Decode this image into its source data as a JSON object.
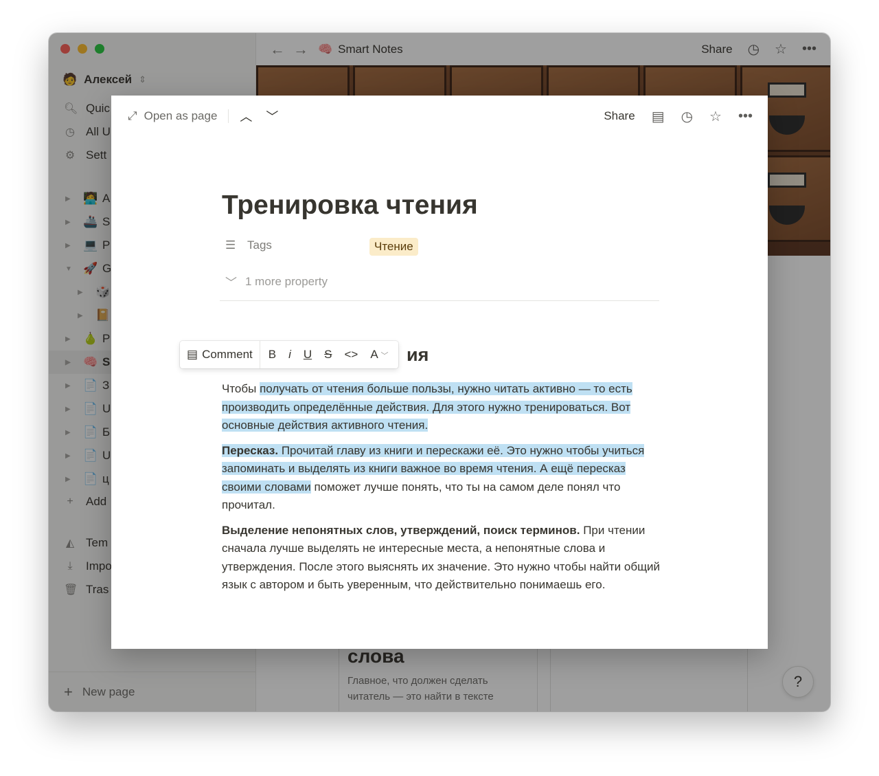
{
  "workspace": {
    "name": "Алексей"
  },
  "sidebar": {
    "nav": [
      {
        "label": "Quic",
        "icon": "search-icon"
      },
      {
        "label": "All U",
        "icon": "clock-icon"
      },
      {
        "label": "Sett",
        "icon": "gear-icon"
      }
    ],
    "tree": [
      {
        "emoji": "🧑‍💻",
        "label": "A",
        "sub": false,
        "active": false
      },
      {
        "emoji": "🚢",
        "label": "S",
        "sub": false,
        "active": false
      },
      {
        "emoji": "💻",
        "label": "P",
        "sub": false,
        "active": false
      },
      {
        "emoji": "🚀",
        "label": "G",
        "sub": false,
        "active": false
      },
      {
        "emoji": "🎲",
        "label": "",
        "sub": true,
        "active": false
      },
      {
        "emoji": "📔",
        "label": "",
        "sub": true,
        "active": false
      },
      {
        "emoji": "🍐",
        "label": "P",
        "sub": false,
        "active": false
      },
      {
        "emoji": "🧠",
        "label": "S",
        "sub": false,
        "active": true
      },
      {
        "emoji": "📄",
        "label": "З",
        "sub": false,
        "active": false
      },
      {
        "emoji": "📄",
        "label": "U",
        "sub": false,
        "active": false
      },
      {
        "emoji": "📄",
        "label": "Б",
        "sub": false,
        "active": false
      },
      {
        "emoji": "📄",
        "label": "U",
        "sub": false,
        "active": false
      },
      {
        "emoji": "📄",
        "label": "ц",
        "sub": false,
        "active": false
      }
    ],
    "add_label": "Add",
    "bottom": [
      {
        "label": "Tem",
        "icon": "shapes-icon"
      },
      {
        "label": "Impo",
        "icon": "download-icon"
      },
      {
        "label": "Tras",
        "icon": "trash-icon"
      }
    ],
    "new_page": "New page"
  },
  "topbar": {
    "emoji": "🧠",
    "title": "Smart Notes",
    "share": "Share"
  },
  "background_card": {
    "heading": "слова",
    "text": "Главное, что должен сделать читатель — это найти в тексте"
  },
  "help": "?",
  "modal": {
    "open_as_page": "Open as page",
    "share": "Share",
    "title": "Тренировка чтения",
    "prop_tags_label": "Tags",
    "tag_value": "Чтение",
    "more_property": "1 more property",
    "heading_visible": "ия",
    "toolbar": {
      "comment": "Comment",
      "bold": "B",
      "italic": "i",
      "underline": "U",
      "strike": "S",
      "code": "<>",
      "color": "A"
    },
    "p1_plain": "Чтобы ",
    "p1_hl": "получать от чтения больше пользы, нужно читать активно — то есть производить определённые действия. Для этого нужно тренироваться. Вот основные действия активного чтения.",
    "p2_bold": "Пересказ.",
    "p2_hl": " Прочитай главу из книги и перескажи её. Это нужно чтобы учиться запоминать и выделять из книги важное во время чтения. А ещё пересказ своими словами",
    "p2_rest": " поможет лучше понять, что ты на самом деле понял что прочитал.",
    "p3_bold": "Выделение непонятных слов, утверждений, поиск терминов.",
    "p3_rest": " При чтении сначала лучше выделять не интересные места, а непонятные слова и утверждения. После этого выяснять их значение. Это нужно чтобы найти общий язык с автором и быть уверенным, что действительно понимаешь его."
  }
}
